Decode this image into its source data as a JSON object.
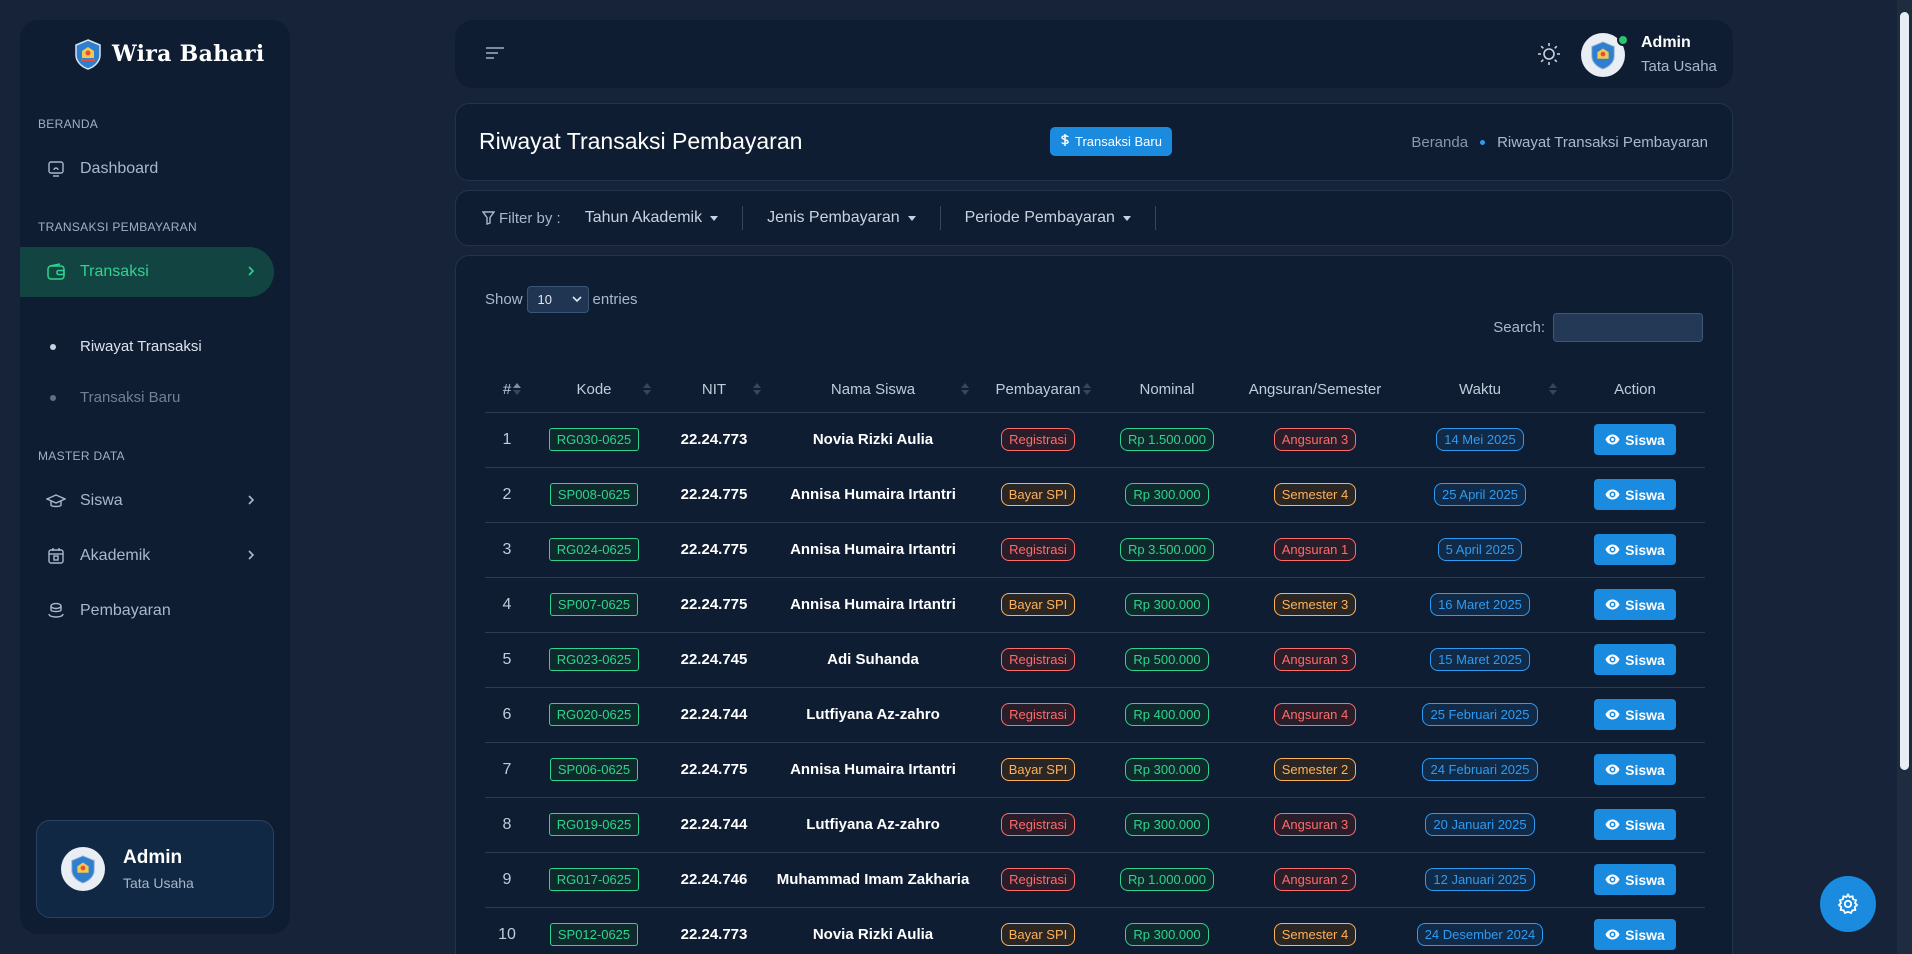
{
  "brand": {
    "name": "Wira Bahari"
  },
  "sidebar": {
    "sections": [
      {
        "title": "BERANDA"
      },
      {
        "title": "TRANSAKSI PEMBAYARAN"
      },
      {
        "title": "MASTER DATA"
      }
    ],
    "items": [
      {
        "label": "Dashboard",
        "icon": "monitor-icon"
      },
      {
        "label": "Transaksi",
        "icon": "wallet-icon",
        "active": true
      },
      {
        "label": "Siswa",
        "icon": "graduation-cap-icon"
      },
      {
        "label": "Akademik",
        "icon": "calendar-icon"
      },
      {
        "label": "Pembayaran",
        "icon": "coins-icon"
      }
    ],
    "subitems": [
      {
        "label": "Riwayat Transaksi",
        "active": true
      },
      {
        "label": "Transaksi Baru",
        "active": false
      }
    ],
    "user": {
      "name": "Admin",
      "role": "Tata Usaha"
    }
  },
  "topbar": {
    "user_name": "Admin",
    "user_role": "Tata Usaha"
  },
  "page": {
    "title": "Riwayat Transaksi Pembayaran",
    "new_button": "Transaksi Baru",
    "breadcrumb": [
      "Beranda",
      "Riwayat Transaksi Pembayaran"
    ]
  },
  "filter": {
    "label": "Filter by :",
    "dropdowns": [
      "Tahun Akademik",
      "Jenis Pembayaran",
      "Periode Pembayaran"
    ]
  },
  "table_controls": {
    "show": "Show",
    "entries_value": "10",
    "entries": "entries",
    "search_label": "Search:"
  },
  "table": {
    "columns": [
      "#",
      "Kode",
      "NIT",
      "Nama Siswa",
      "Pembayaran",
      "Nominal",
      "Angsuran/Semester",
      "Waktu",
      "Action"
    ],
    "action_label": "Siswa",
    "rows": [
      {
        "no": "1",
        "kode": "RG030-0625",
        "nit": "22.24.773",
        "nama": "Novia Rizki Aulia",
        "pembayaran": "Registrasi",
        "nominal": "Rp 1.500.000",
        "angsuran": "Angsuran 3",
        "waktu": "14 Mei 2025"
      },
      {
        "no": "2",
        "kode": "SP008-0625",
        "nit": "22.24.775",
        "nama": "Annisa Humaira Irtantri",
        "pembayaran": "Bayar SPI",
        "nominal": "Rp 300.000",
        "angsuran": "Semester 4",
        "waktu": "25 April 2025"
      },
      {
        "no": "3",
        "kode": "RG024-0625",
        "nit": "22.24.775",
        "nama": "Annisa Humaira Irtantri",
        "pembayaran": "Registrasi",
        "nominal": "Rp 3.500.000",
        "angsuran": "Angsuran 1",
        "waktu": "5 April 2025"
      },
      {
        "no": "4",
        "kode": "SP007-0625",
        "nit": "22.24.775",
        "nama": "Annisa Humaira Irtantri",
        "pembayaran": "Bayar SPI",
        "nominal": "Rp 300.000",
        "angsuran": "Semester 3",
        "waktu": "16 Maret 2025"
      },
      {
        "no": "5",
        "kode": "RG023-0625",
        "nit": "22.24.745",
        "nama": "Adi Suhanda",
        "pembayaran": "Registrasi",
        "nominal": "Rp 500.000",
        "angsuran": "Angsuran 3",
        "waktu": "15 Maret 2025"
      },
      {
        "no": "6",
        "kode": "RG020-0625",
        "nit": "22.24.744",
        "nama": "Lutfiyana Az-zahro",
        "pembayaran": "Registrasi",
        "nominal": "Rp 400.000",
        "angsuran": "Angsuran 4",
        "waktu": "25 Februari 2025"
      },
      {
        "no": "7",
        "kode": "SP006-0625",
        "nit": "22.24.775",
        "nama": "Annisa Humaira Irtantri",
        "pembayaran": "Bayar SPI",
        "nominal": "Rp 300.000",
        "angsuran": "Semester 2",
        "waktu": "24 Februari 2025"
      },
      {
        "no": "8",
        "kode": "RG019-0625",
        "nit": "22.24.744",
        "nama": "Lutfiyana Az-zahro",
        "pembayaran": "Registrasi",
        "nominal": "Rp 300.000",
        "angsuran": "Angsuran 3",
        "waktu": "20 Januari 2025"
      },
      {
        "no": "9",
        "kode": "RG017-0625",
        "nit": "22.24.746",
        "nama": "Muhammad Imam Zakharia",
        "pembayaran": "Registrasi",
        "nominal": "Rp 1.000.000",
        "angsuran": "Angsuran 2",
        "waktu": "12 Januari 2025"
      },
      {
        "no": "10",
        "kode": "SP012-0625",
        "nit": "22.24.773",
        "nama": "Novia Rizki Aulia",
        "pembayaran": "Bayar SPI",
        "nominal": "Rp 300.000",
        "angsuran": "Semester 4",
        "waktu": "24 Desember 2024"
      }
    ]
  },
  "colors": {
    "background": "#162338",
    "panel": "#0f1d32",
    "accent_blue": "#1a8bdf",
    "accent_green": "#2fd38e",
    "badge_red": "#ff6b6b",
    "badge_orange": "#ffb05a"
  }
}
